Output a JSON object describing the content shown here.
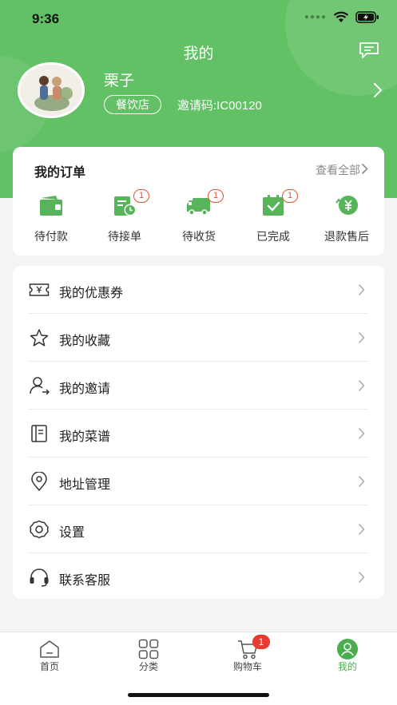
{
  "status_bar": {
    "time": "9:36"
  },
  "header": {
    "title": "我的",
    "user_name": "栗子",
    "store_type": "餐饮店",
    "invite_code": "邀请码:IC00120",
    "accent_color": "#62c165"
  },
  "orders": {
    "title": "我的订单",
    "view_all": "查看全部",
    "items": [
      {
        "label": "待付款",
        "icon": "wallet-icon",
        "badge": ""
      },
      {
        "label": "待接单",
        "icon": "pending-order-icon",
        "badge": "1"
      },
      {
        "label": "待收货",
        "icon": "delivery-truck-icon",
        "badge": "1"
      },
      {
        "label": "已完成",
        "icon": "completed-check-icon",
        "badge": "1"
      },
      {
        "label": "退款售后",
        "icon": "refund-yuan-icon",
        "badge": ""
      }
    ]
  },
  "menu": {
    "items": [
      {
        "label": "我的优惠券",
        "icon": "coupon-icon"
      },
      {
        "label": "我的收藏",
        "icon": "star-icon"
      },
      {
        "label": "我的邀请",
        "icon": "invite-user-icon"
      },
      {
        "label": "我的菜谱",
        "icon": "recipe-book-icon"
      },
      {
        "label": "地址管理",
        "icon": "location-pin-icon"
      },
      {
        "label": "设置",
        "icon": "gear-icon"
      },
      {
        "label": "联系客服",
        "icon": "headset-icon"
      }
    ]
  },
  "tabbar": {
    "tabs": [
      {
        "label": "首页",
        "icon": "home-icon"
      },
      {
        "label": "分类",
        "icon": "category-grid-icon"
      },
      {
        "label": "购物车",
        "icon": "cart-icon",
        "badge": "1"
      },
      {
        "label": "我的",
        "icon": "profile-icon",
        "active": true
      }
    ],
    "active_color": "#4aae4f"
  }
}
